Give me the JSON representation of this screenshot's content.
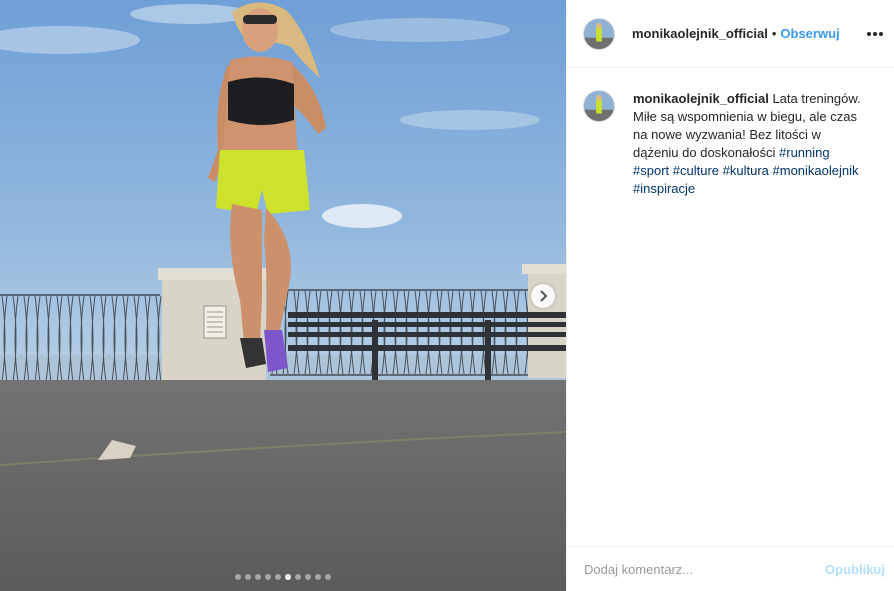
{
  "profile": {
    "username": "monikaolejnik_official",
    "separator": "•",
    "follow_label": "Obserwuj",
    "more_icon": "more-options-icon"
  },
  "caption": {
    "username": "monikaolejnik_official",
    "text": "Lata treningów. Miłe są wspomnienia w biegu, ale czas na nowe wyzwania! Bez litości w dążeniu do doskonałości",
    "hashtags": [
      "#running",
      "#sport",
      "#culture",
      "#kultura",
      "#monikaolejnik",
      "#inspiracje"
    ]
  },
  "carousel": {
    "total_slides": 10,
    "active_slide": 6,
    "next_icon": "chevron-right-icon"
  },
  "comment": {
    "placeholder": "Dodaj komentarz...",
    "post_label": "Opublikuj"
  },
  "colors": {
    "accent": "#3897f0",
    "hashtag": "#003569",
    "post_disabled": "#b2dffc"
  }
}
